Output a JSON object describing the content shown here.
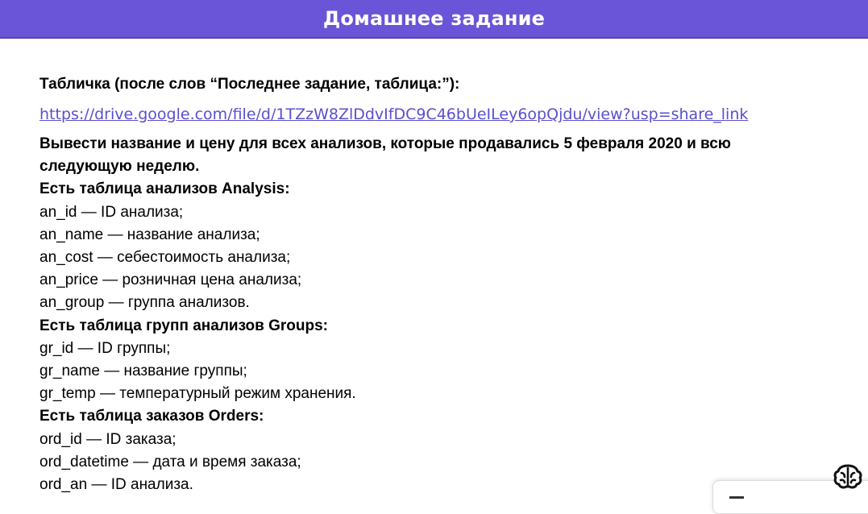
{
  "header": {
    "title": "Домашнее задание"
  },
  "content": {
    "intro": "Табличка (после слов “Последнее задание, таблица:”):",
    "link": "https://drive.google.com/file/d/1TZzW8ZlDdvIfDC9C46bUeILey6opQjdu/view?usp=share_link",
    "task_line1": "Вывести название и цену для всех анализов, которые продавались 5 февраля 2020 и всю",
    "task_line2": "следующую неделю.",
    "analysis": {
      "title": "Есть таблица анализов Analysis:",
      "fields": [
        "an_id — ID анализа;",
        "an_name — название анализа;",
        "an_cost — себестоимость анализа;",
        "an_price — розничная цена анализа;",
        "an_group — группа анализов."
      ]
    },
    "groups": {
      "title": "Есть таблица групп анализов Groups:",
      "fields": [
        "gr_id — ID группы;",
        "gr_name — название группы;",
        "gr_temp — температурный режим хранения."
      ]
    },
    "orders": {
      "title": "Есть таблица заказов Orders:",
      "fields": [
        "ord_id — ID заказа;",
        "ord_datetime — дата и время заказа;",
        "ord_an — ID анализа."
      ]
    }
  },
  "icons": {
    "corner": "brain-icon"
  }
}
